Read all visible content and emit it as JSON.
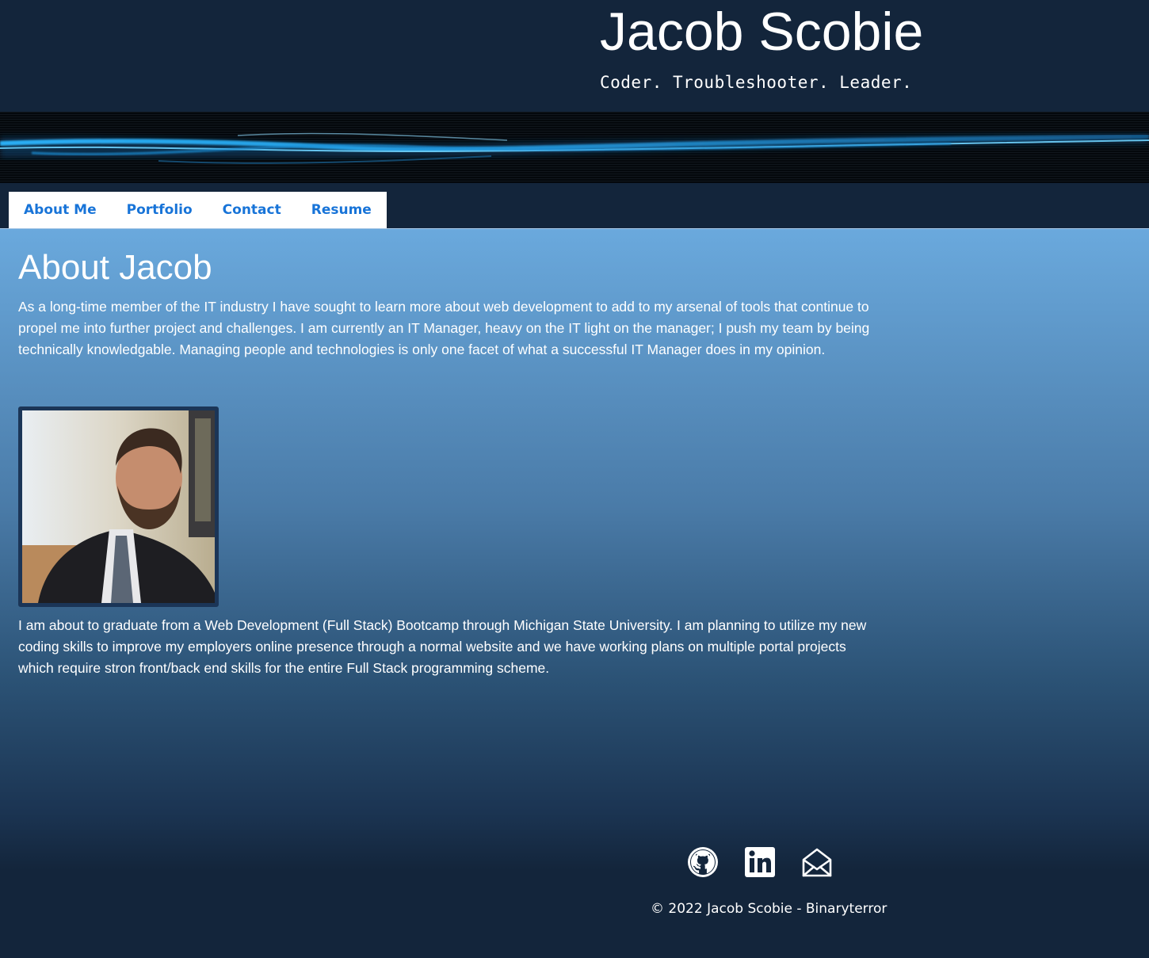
{
  "header": {
    "title": "Jacob Scobie",
    "tagline": "Coder. Troubleshooter. Leader."
  },
  "nav": {
    "items": [
      {
        "label": "About Me"
      },
      {
        "label": "Portfolio"
      },
      {
        "label": "Contact"
      },
      {
        "label": "Resume"
      }
    ]
  },
  "about": {
    "title": "About Jacob",
    "paragraph_1": "As a long-time member of the IT industry I have sought to learn more about web development to add to my arsenal of tools that continue to propel me into further project and challenges. I am currently an IT Manager, heavy on the IT light on the manager; I push my team by being technically knowledgable. Managing people and technologies is only one facet of what a successful IT Manager does in my opinion.",
    "paragraph_2": "I am about to graduate from a Web Development (Full Stack) Bootcamp through Michigan State University. I am planning to utilize my new coding skills to improve my employers online presence through a normal website and we have working plans on multiple portal projects which require stron front/back end skills for the entire Full Stack programming scheme."
  },
  "footer": {
    "icons": [
      "github-icon",
      "linkedin-icon",
      "envelope-open-icon"
    ],
    "copyright": "© 2022 Jacob Scobie - Binaryterror"
  },
  "colors": {
    "header_bg": "#13253b",
    "nav_link": "#1874d8",
    "gradient_top": "#6aa9dd",
    "photo_border": "#1b3557",
    "text": "#ffffff"
  }
}
